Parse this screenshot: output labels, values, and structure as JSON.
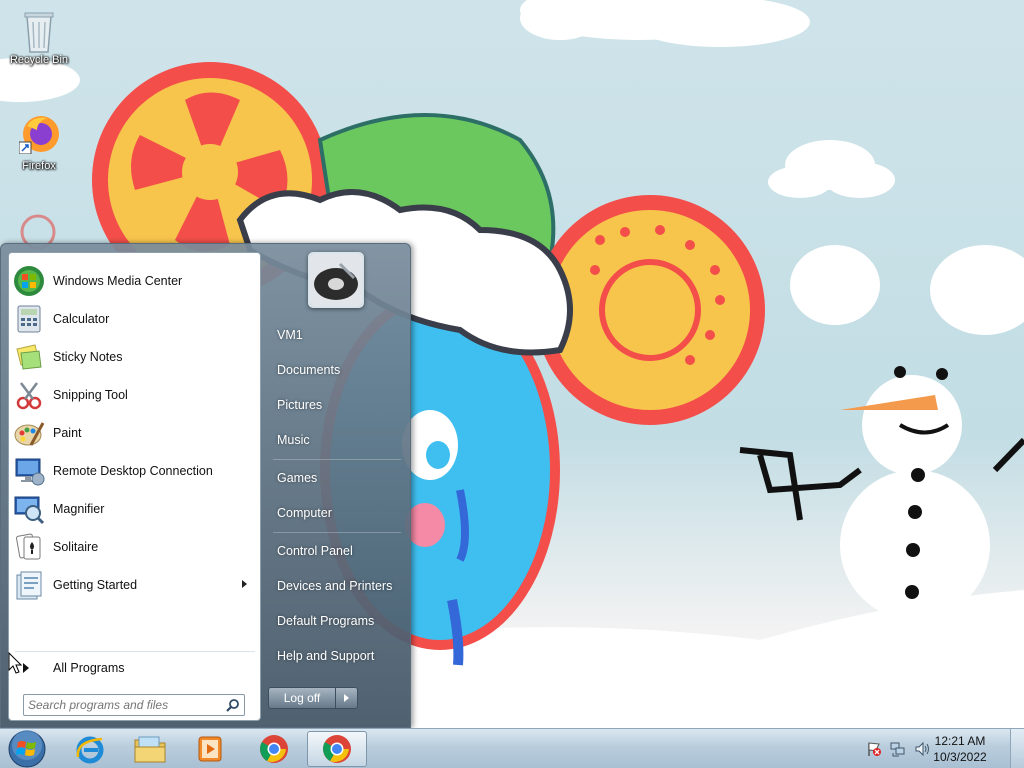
{
  "desktop": {
    "icons": [
      {
        "label": "Recycle Bin",
        "icon": "recycle-bin-icon"
      },
      {
        "label": "Firefox",
        "icon": "firefox-icon"
      }
    ]
  },
  "start_menu": {
    "programs": [
      {
        "label": "Windows Media Center",
        "icon": "windows-media-center-icon"
      },
      {
        "label": "Calculator",
        "icon": "calculator-icon"
      },
      {
        "label": "Sticky Notes",
        "icon": "sticky-notes-icon"
      },
      {
        "label": "Snipping Tool",
        "icon": "snipping-tool-icon"
      },
      {
        "label": "Paint",
        "icon": "paint-icon"
      },
      {
        "label": "Remote Desktop Connection",
        "icon": "remote-desktop-icon"
      },
      {
        "label": "Magnifier",
        "icon": "magnifier-icon"
      },
      {
        "label": "Solitaire",
        "icon": "solitaire-icon"
      },
      {
        "label": "Getting Started",
        "icon": "getting-started-icon",
        "has_submenu": true
      }
    ],
    "all_programs_label": "All Programs",
    "search_placeholder": "Search programs and files",
    "right_items": [
      {
        "label": "VM1"
      },
      {
        "label": "Documents"
      },
      {
        "label": "Pictures"
      },
      {
        "label": "Music"
      },
      {
        "label": "Games"
      },
      {
        "label": "Computer"
      },
      {
        "label": "Control Panel"
      },
      {
        "label": "Devices and Printers"
      },
      {
        "label": "Default Programs"
      },
      {
        "label": "Help and Support"
      }
    ],
    "logoff_label": "Log off"
  },
  "taskbar": {
    "pinned": [
      {
        "icon": "internet-explorer-icon"
      },
      {
        "icon": "file-explorer-icon"
      },
      {
        "icon": "media-player-icon"
      },
      {
        "icon": "chrome-icon"
      },
      {
        "icon": "chrome-icon",
        "active": true
      }
    ],
    "tray_icons": [
      "action-center-flag-icon",
      "network-icon",
      "volume-icon"
    ],
    "clock": {
      "time": "12:21 AM",
      "date": "10/3/2022"
    }
  },
  "colors": {
    "start_menu_glass": "#5f7486",
    "taskbar": "#b9cddd",
    "sky": "#c2dde4"
  }
}
